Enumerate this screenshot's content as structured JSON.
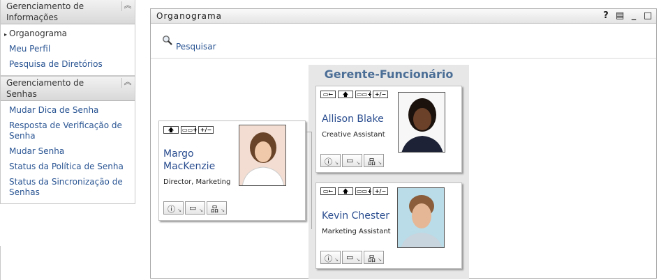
{
  "sidebar": {
    "sections": [
      {
        "title": "Gerenciamento de Informações",
        "items": [
          {
            "label": "Organograma",
            "active": true
          },
          {
            "label": "Meu Perfil"
          },
          {
            "label": "Pesquisa de Diretórios"
          }
        ]
      },
      {
        "title": "Gerenciamento de Senhas",
        "items": [
          {
            "label": "Mudar Dica de Senha"
          },
          {
            "label": "Resposta de Verificação de Senha"
          },
          {
            "label": "Mudar Senha"
          },
          {
            "label": "Status da Política de Senha"
          },
          {
            "label": "Status da Sincronização de Senhas"
          }
        ]
      }
    ],
    "collapse_glyph": "⌃"
  },
  "main": {
    "title": "Organograma",
    "header_icons": [
      "help-icon",
      "print-icon",
      "minimize-icon",
      "maximize-icon"
    ],
    "search_label": "Pesquisar"
  },
  "orgchart": {
    "relationship_title": "Gerente-Funcionário",
    "manager": {
      "name": "Margo MacKenzie",
      "role": "Director, Marketing"
    },
    "reports": [
      {
        "name": "Allison Blake",
        "role": "Creative Assistant"
      },
      {
        "name": "Kevin Chester",
        "role": "Marketing Assistant"
      }
    ]
  },
  "colors": {
    "link": "#2a5593",
    "name": "#2a4d8f",
    "group_title": "#4b6e96",
    "chart_bg": "#e7e7e7"
  }
}
